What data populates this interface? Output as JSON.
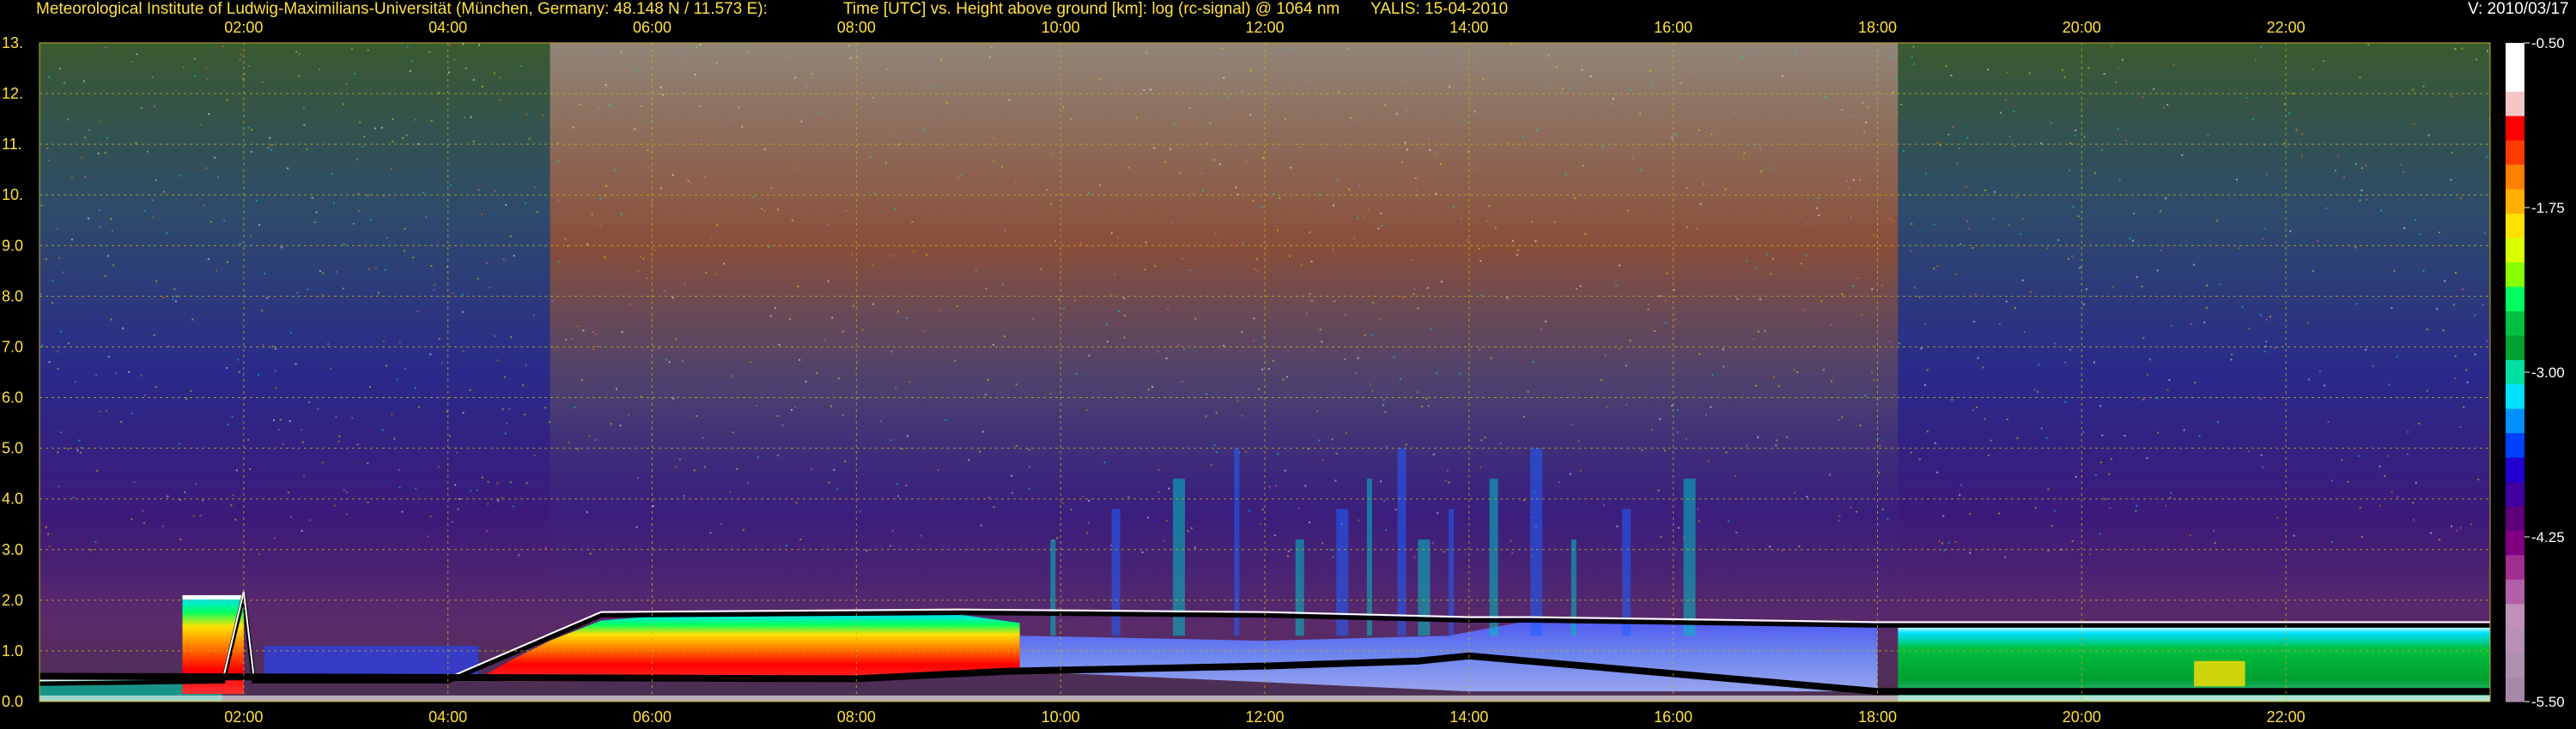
{
  "header": {
    "institute": "Meteorological Institute of Ludwig-Maximilians-Universität (München, Germany: 48.148 N / 11.573 E):",
    "axes_description": "Time [UTC] vs. Height above ground [km]: log (rc-signal) @ 1064 nm",
    "station_date": "YALIS: 15-04-2010",
    "version": "V: 2010/03/17"
  },
  "chart_data": {
    "type": "heatmap",
    "x_ticks": [
      "02:00",
      "04:00",
      "06:00",
      "08:00",
      "10:00",
      "12:00",
      "14:00",
      "16:00",
      "18:00",
      "20:00",
      "22:00"
    ],
    "x_tick_hours": [
      2,
      4,
      6,
      8,
      10,
      12,
      14,
      16,
      18,
      20,
      22
    ],
    "xlim_hours": [
      0,
      24
    ],
    "y_ticks": [
      "0.0",
      "1.0",
      "2.0",
      "3.0",
      "4.0",
      "5.0",
      "6.0",
      "7.0",
      "8.0",
      "9.0",
      "10.",
      "11.",
      "12.",
      "13."
    ],
    "y_tick_values": [
      0,
      1,
      2,
      3,
      4,
      5,
      6,
      7,
      8,
      9,
      10,
      11,
      12,
      13
    ],
    "ylim_km": [
      0,
      13
    ],
    "grid": true,
    "colorbar": {
      "labels": [
        "-0.50",
        "-1.75",
        "-3.00",
        "-4.25",
        "-5.50"
      ],
      "values": [
        -0.5,
        -1.75,
        -3.0,
        -4.25,
        -5.5
      ],
      "range": [
        -5.5,
        -0.5
      ],
      "colors": [
        "#ffffff",
        "#ffffff",
        "#f6c6c6",
        "#ff0000",
        "#ff3c00",
        "#ff8000",
        "#ffb000",
        "#ffe000",
        "#d8ff00",
        "#88ff00",
        "#00ff60",
        "#00c040",
        "#00a030",
        "#00e0a0",
        "#00e0ff",
        "#0090ff",
        "#0040ff",
        "#2000d0",
        "#4000a0",
        "#60007a",
        "#800080",
        "#a03090",
        "#b060a8",
        "#c090b8",
        "#b890b8",
        "#b090b0",
        "#a888a8"
      ]
    },
    "layers_description": {
      "boundary_layer_top_km": [
        [
          0,
          0.35
        ],
        [
          1.8,
          0.4
        ],
        [
          2,
          2.1
        ],
        [
          2.1,
          0.4
        ],
        [
          4,
          0.4
        ],
        [
          5.5,
          1.7
        ],
        [
          9,
          1.75
        ],
        [
          12,
          1.7
        ],
        [
          14,
          1.6
        ],
        [
          14.6,
          1.6
        ],
        [
          18,
          1.5
        ],
        [
          22,
          1.5
        ],
        [
          24,
          1.5
        ]
      ],
      "signal_floor_km": [
        [
          0,
          0.5
        ],
        [
          8,
          0.45
        ],
        [
          9.5,
          0.6
        ],
        [
          12,
          0.7
        ],
        [
          13.5,
          0.8
        ],
        [
          14,
          0.9
        ],
        [
          18,
          0.2
        ],
        [
          24,
          0.2
        ]
      ]
    }
  }
}
